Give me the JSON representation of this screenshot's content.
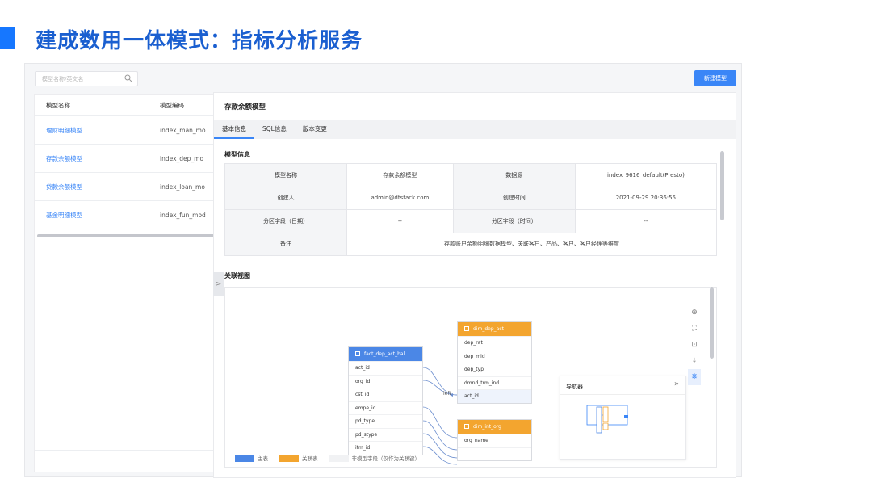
{
  "slide": {
    "title": "建成数用一体模式：指标分析服务"
  },
  "search": {
    "placeholder": "模型名称/英文名"
  },
  "toolbar": {
    "new_label": "新建模型"
  },
  "list": {
    "headers": [
      "模型名称",
      "模型编码"
    ],
    "rows": [
      {
        "name": "理财明细模型",
        "code": "index_man_mo"
      },
      {
        "name": "存款余额模型",
        "code": "index_dep_mo"
      },
      {
        "name": "贷款余额模型",
        "code": "index_loan_mo"
      },
      {
        "name": "基金明细模型",
        "code": "index_fun_mod"
      }
    ]
  },
  "collapse": {
    "glyph": ">"
  },
  "detail": {
    "title": "存款余额模型",
    "tabs": [
      "基本信息",
      "SQL信息",
      "版本变更"
    ],
    "section_info": "模型信息",
    "info": {
      "r1": {
        "l1": "模型名称",
        "v1": "存款余额模型",
        "l2": "数据源",
        "v2": "index_9616_default(Presto)"
      },
      "r2": {
        "l1": "创建人",
        "v1": "admin@dtstack.com",
        "l2": "创建时间",
        "v2": "2021-09-29 20:36:55"
      },
      "r3": {
        "l1": "分区字段（日期）",
        "v1": "--",
        "l2": "分区字段（时间）",
        "v2": "--"
      },
      "r4": {
        "l1": "备注",
        "v1": "存款账户余额明细数据模型、关联客户、产品、客户、客户经理等维度"
      }
    },
    "section_graph": "关联视图"
  },
  "graph": {
    "main_table": {
      "name": "fact_dep_act_bal",
      "fields": [
        "act_id",
        "org_id",
        "cst_id",
        "empe_id",
        "pd_type",
        "pd_stype",
        "itm_id"
      ]
    },
    "dim_table1": {
      "name": "dim_dep_act",
      "fields": [
        "dep_rat",
        "dep_mid",
        "dep_typ",
        "dmnd_trm_ind",
        "act_id"
      ]
    },
    "dim_table2": {
      "name": "dim_int_org",
      "fields": [
        "org_name"
      ]
    },
    "join_label": "left",
    "navigator": {
      "title": "导航器",
      "toggle": "»"
    },
    "legend": [
      "主表",
      "关联表",
      "非模型字段（仅作为关联键）"
    ],
    "colors": {
      "main": "#4b87e6",
      "related": "#f3a52f",
      "non_model": "#f1f2f4"
    }
  },
  "tools": [
    "zoom-in-icon",
    "fit-view-icon",
    "select-box-icon",
    "download-icon",
    "settings-icon"
  ]
}
